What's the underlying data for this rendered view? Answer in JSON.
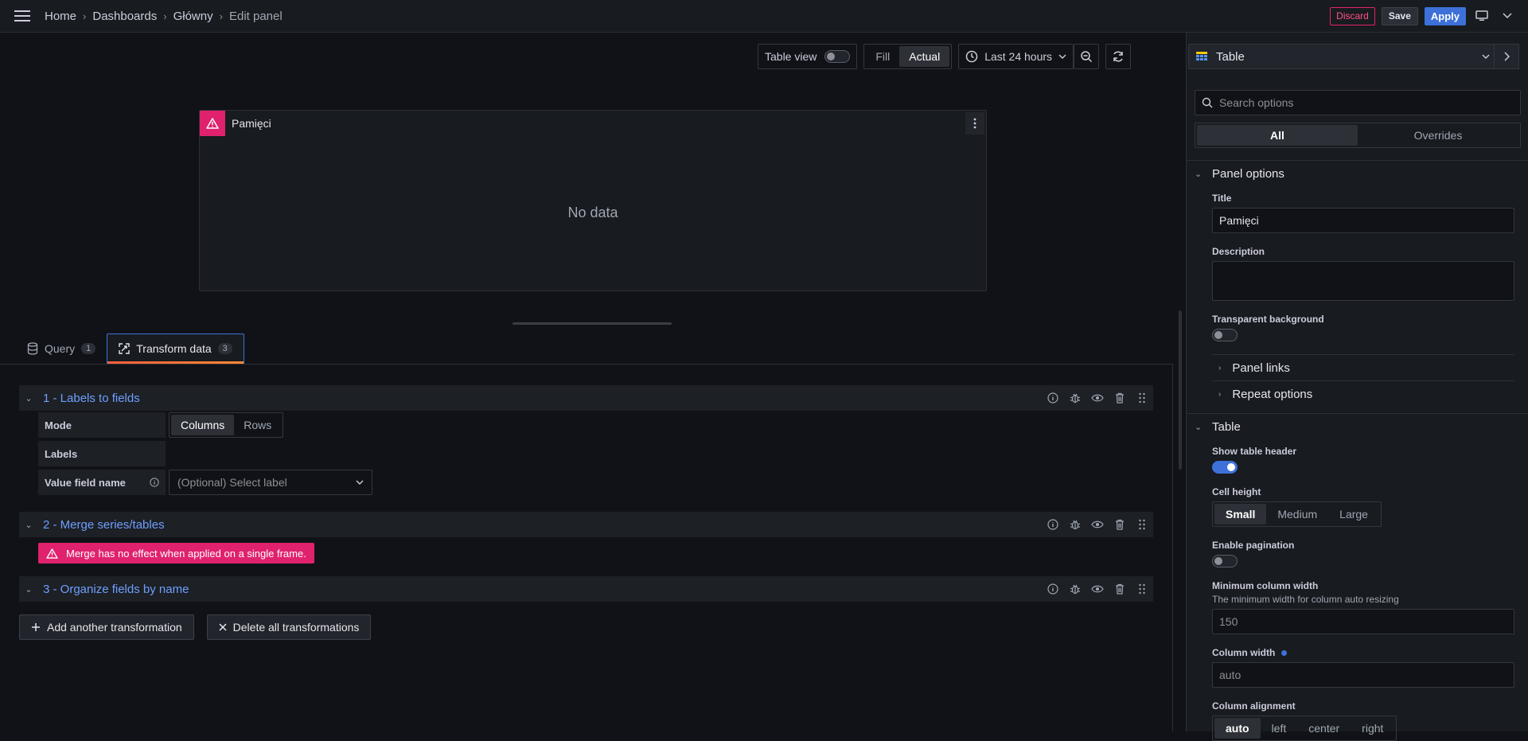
{
  "breadcrumb": [
    "Home",
    "Dashboards",
    "Główny",
    "Edit panel"
  ],
  "top_actions": {
    "discard": "Discard",
    "save": "Save",
    "apply": "Apply"
  },
  "toolbar": {
    "table_view": "Table view",
    "table_view_on": false,
    "fill": "Fill",
    "actual": "Actual",
    "actual_selected": true,
    "time_range": "Last 24 hours"
  },
  "panel": {
    "title": "Pamięci",
    "no_data": "No data"
  },
  "tabs": [
    {
      "label": "Query",
      "count": "1"
    },
    {
      "label": "Transform data",
      "count": "3"
    }
  ],
  "transformations": [
    {
      "title": "1 - Labels to fields"
    },
    {
      "title": "2 - Merge series/tables"
    },
    {
      "title": "3 - Organize fields by name"
    }
  ],
  "labels_to_fields": {
    "mode_label": "Mode",
    "mode_options": [
      "Columns",
      "Rows"
    ],
    "mode_selected": "Columns",
    "labels_label": "Labels",
    "value_field_label": "Value field name",
    "value_field_placeholder": "(Optional) Select label"
  },
  "merge_alert": "Merge has no effect when applied on a single frame.",
  "bottom_buttons": {
    "add": "Add another transformation",
    "delete": "Delete all transformations"
  },
  "sidebar": {
    "viz": "Table",
    "search_placeholder": "Search options",
    "tabs": [
      "All",
      "Overrides"
    ],
    "panel_options": {
      "header": "Panel options",
      "title_label": "Title",
      "title_value": "Pamięci",
      "description_label": "Description",
      "transparent_label": "Transparent background",
      "transparent_on": false,
      "panel_links": "Panel links",
      "repeat_options": "Repeat options"
    },
    "table": {
      "header": "Table",
      "show_header_label": "Show table header",
      "show_header_on": true,
      "cell_height_label": "Cell height",
      "cell_height_options": [
        "Small",
        "Medium",
        "Large"
      ],
      "cell_height_selected": "Small",
      "pagination_label": "Enable pagination",
      "pagination_on": false,
      "min_width_label": "Minimum column width",
      "min_width_desc": "The minimum width for column auto resizing",
      "min_width_placeholder": "150",
      "col_width_label": "Column width",
      "col_width_placeholder": "auto",
      "alignment_label": "Column alignment",
      "alignment_options": [
        "auto",
        "left",
        "center",
        "right"
      ],
      "alignment_selected": "auto"
    }
  }
}
